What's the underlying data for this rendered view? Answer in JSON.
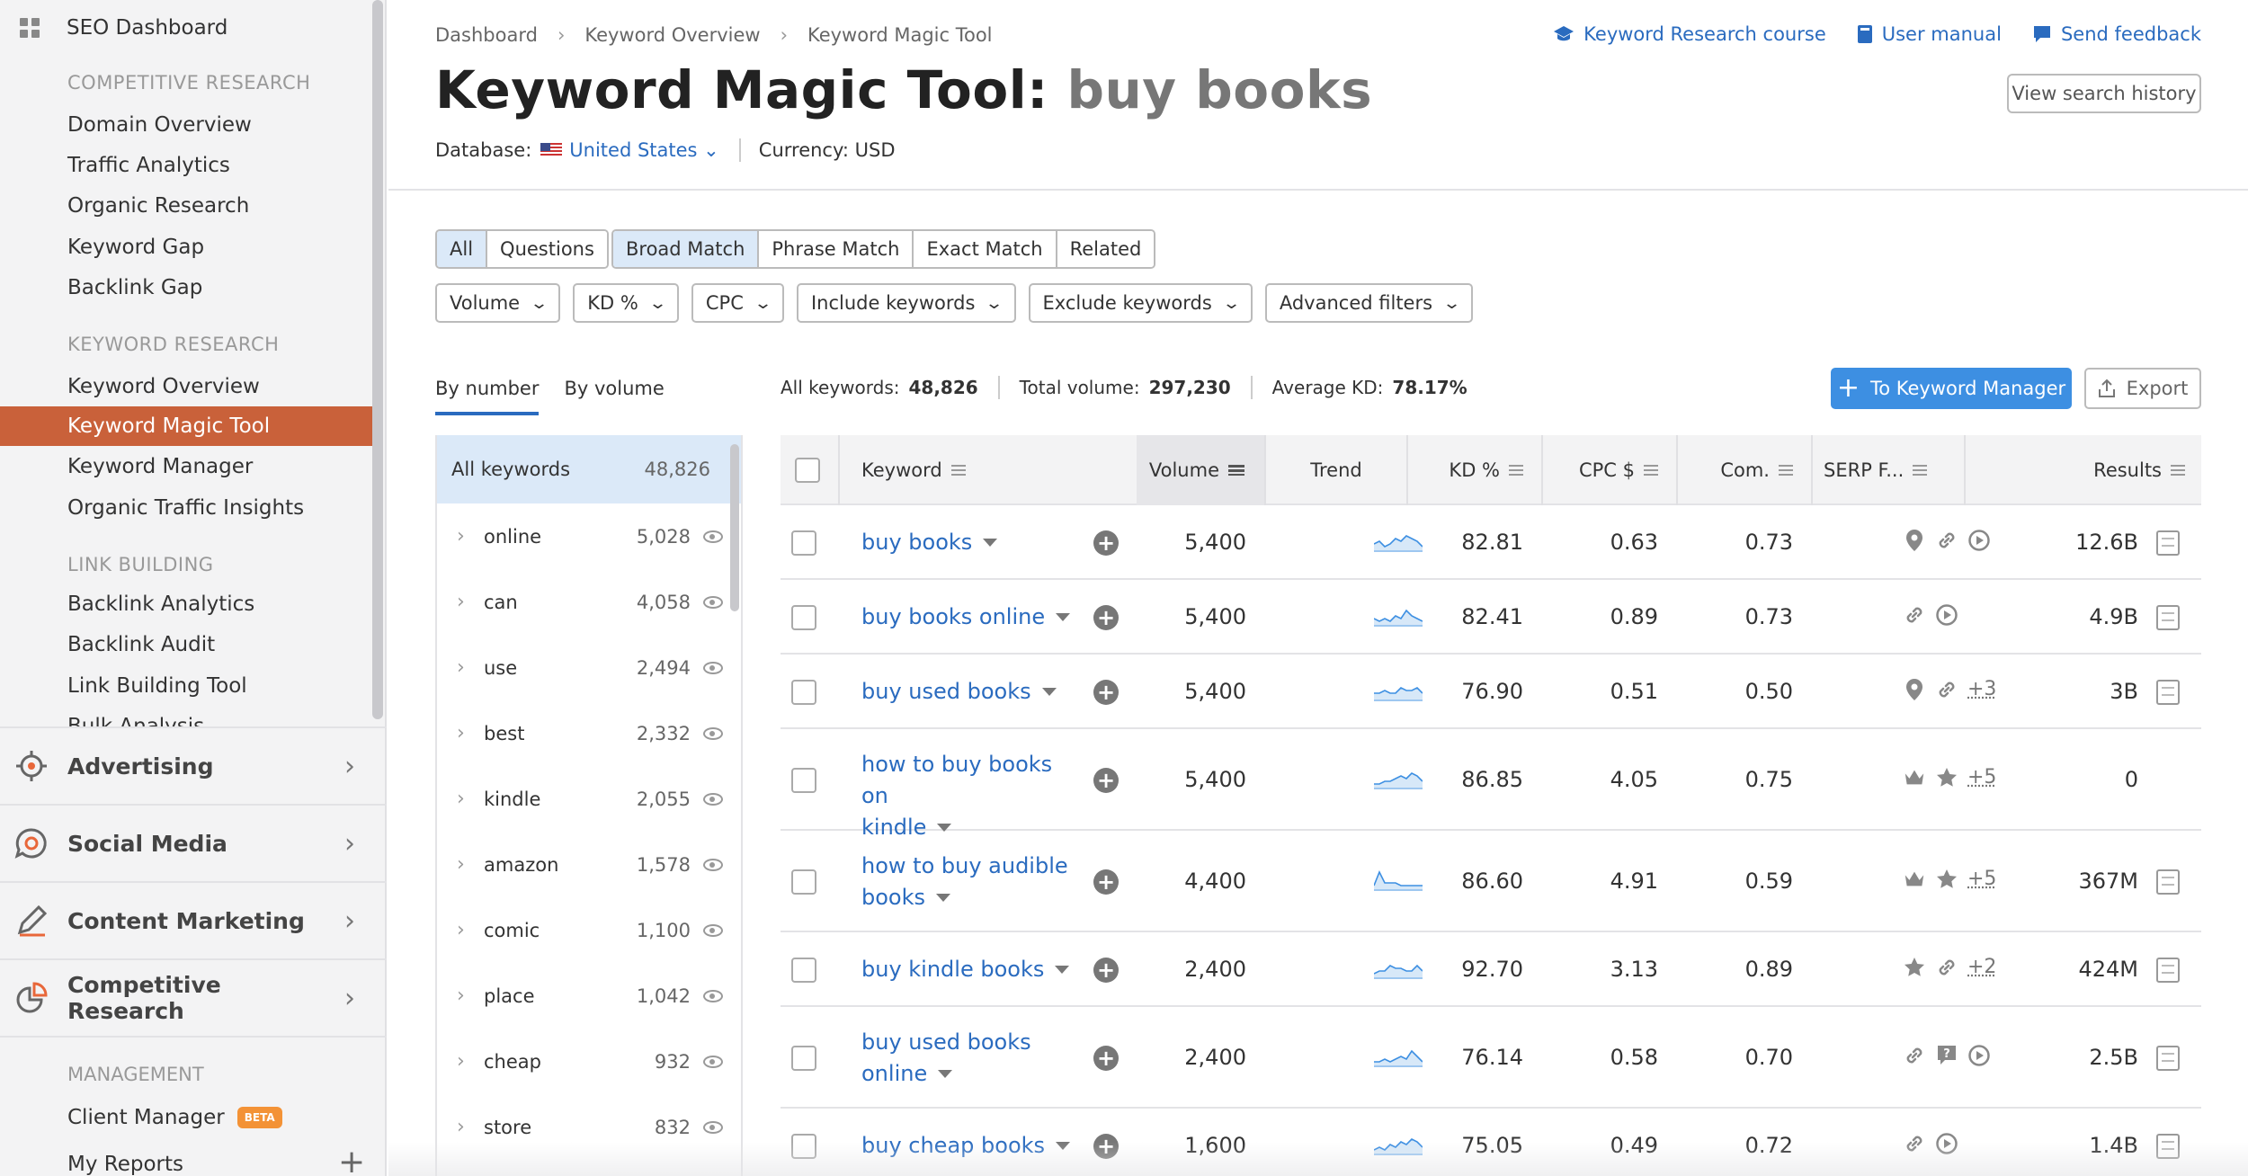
{
  "sidebar": {
    "dashboard": "SEO Dashboard",
    "sections": [
      {
        "title": "COMPETITIVE RESEARCH",
        "items": [
          "Domain Overview",
          "Traffic Analytics",
          "Organic Research",
          "Keyword Gap",
          "Backlink Gap"
        ]
      },
      {
        "title": "KEYWORD RESEARCH",
        "items": [
          "Keyword Overview",
          "Keyword Magic Tool",
          "Keyword Manager",
          "Organic Traffic Insights"
        ]
      },
      {
        "title": "LINK BUILDING",
        "items": [
          "Backlink Analytics",
          "Backlink Audit",
          "Link Building Tool"
        ]
      }
    ],
    "cut_item": "Bulk Analysis",
    "active_item": "Keyword Magic Tool",
    "groups": [
      "Advertising",
      "Social Media",
      "Content Marketing",
      "Competitive Research"
    ],
    "management_title": "MANAGEMENT",
    "client_manager": "Client Manager",
    "beta": "BETA",
    "my_reports": "My Reports"
  },
  "header": {
    "breadcrumbs": [
      "Dashboard",
      "Keyword Overview",
      "Keyword Magic Tool"
    ],
    "links": [
      "Keyword Research course",
      "User manual",
      "Send feedback"
    ],
    "title": "Keyword Magic Tool:",
    "query": "buy books",
    "history_button": "View search history",
    "database_label": "Database:",
    "database_value": "United States",
    "currency_label": "Currency:",
    "currency_value": "USD"
  },
  "filters": {
    "type_tabs": [
      "All",
      "Questions"
    ],
    "match_tabs": [
      "Broad Match",
      "Phrase Match",
      "Exact Match",
      "Related"
    ],
    "dropdowns": [
      "Volume",
      "KD %",
      "CPC",
      "Include keywords",
      "Exclude keywords",
      "Advanced filters"
    ]
  },
  "groups_panel": {
    "tabs": [
      "By number",
      "By volume"
    ],
    "all_label": "All keywords",
    "all_count": "48,826",
    "items": [
      {
        "label": "online",
        "count": "5,028"
      },
      {
        "label": "can",
        "count": "4,058"
      },
      {
        "label": "use",
        "count": "2,494"
      },
      {
        "label": "best",
        "count": "2,332"
      },
      {
        "label": "kindle",
        "count": "2,055"
      },
      {
        "label": "amazon",
        "count": "1,578"
      },
      {
        "label": "comic",
        "count": "1,100"
      },
      {
        "label": "place",
        "count": "1,042"
      },
      {
        "label": "cheap",
        "count": "932"
      },
      {
        "label": "store",
        "count": "832"
      }
    ]
  },
  "stats": {
    "all_keywords_label": "All keywords:",
    "all_keywords_value": "48,826",
    "total_volume_label": "Total volume:",
    "total_volume_value": "297,230",
    "avg_kd_label": "Average KD:",
    "avg_kd_value": "78.17%",
    "to_manager": "To Keyword Manager",
    "export": "Export"
  },
  "table": {
    "columns": [
      "Keyword",
      "Volume",
      "Trend",
      "KD %",
      "CPC $",
      "Com.",
      "SERP F...",
      "Results"
    ],
    "rows": [
      {
        "kw1": "buy books",
        "kw2": "",
        "volume": "5,400",
        "kd": "82.81",
        "cpc": "0.63",
        "com": "0.73",
        "serp": [
          "pin",
          "link",
          "play"
        ],
        "more": "",
        "results": "12.6B"
      },
      {
        "kw1": "buy books online",
        "kw2": "",
        "volume": "5,400",
        "kd": "82.41",
        "cpc": "0.89",
        "com": "0.73",
        "serp": [
          "link",
          "play"
        ],
        "more": "",
        "results": "4.9B"
      },
      {
        "kw1": "buy used books",
        "kw2": "",
        "volume": "5,400",
        "kd": "76.90",
        "cpc": "0.51",
        "com": "0.50",
        "serp": [
          "pin",
          "link"
        ],
        "more": "+3",
        "results": "3B"
      },
      {
        "kw1": "how to buy books on",
        "kw2": "kindle",
        "volume": "5,400",
        "kd": "86.85",
        "cpc": "4.05",
        "com": "0.75",
        "serp": [
          "crown",
          "star"
        ],
        "more": "+5",
        "results": "0"
      },
      {
        "kw1": "how to buy audible",
        "kw2": "books",
        "volume": "4,400",
        "kd": "86.60",
        "cpc": "4.91",
        "com": "0.59",
        "serp": [
          "crown",
          "star"
        ],
        "more": "+5",
        "results": "367M"
      },
      {
        "kw1": "buy kindle books",
        "kw2": "",
        "volume": "2,400",
        "kd": "92.70",
        "cpc": "3.13",
        "com": "0.89",
        "serp": [
          "star",
          "link"
        ],
        "more": "+2",
        "results": "424M"
      },
      {
        "kw1": "buy used books",
        "kw2": "online",
        "volume": "2,400",
        "kd": "76.14",
        "cpc": "0.58",
        "com": "0.70",
        "serp": [
          "link",
          "faq",
          "play"
        ],
        "more": "",
        "results": "2.5B"
      },
      {
        "kw1": "buy cheap books",
        "kw2": "",
        "volume": "1,600",
        "kd": "75.05",
        "cpc": "0.49",
        "com": "0.72",
        "serp": [
          "link",
          "play"
        ],
        "more": "",
        "results": "1.4B"
      }
    ]
  },
  "colors": {
    "accent": "#2a6bbf",
    "active": "#c9613a",
    "primary_button": "#3d8fe2"
  }
}
